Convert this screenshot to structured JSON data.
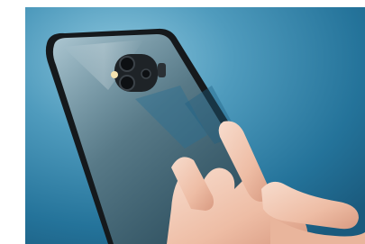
{
  "image": {
    "subject": "smartphone-in-clear-case",
    "colors": {
      "background_light": "#5ea9c8",
      "background_dark": "#1d5f83",
      "phone_frame": "#15191c",
      "glass_tint": "#9fd0e6",
      "skin": "#f1c8b3",
      "border": "#ffffff"
    }
  }
}
